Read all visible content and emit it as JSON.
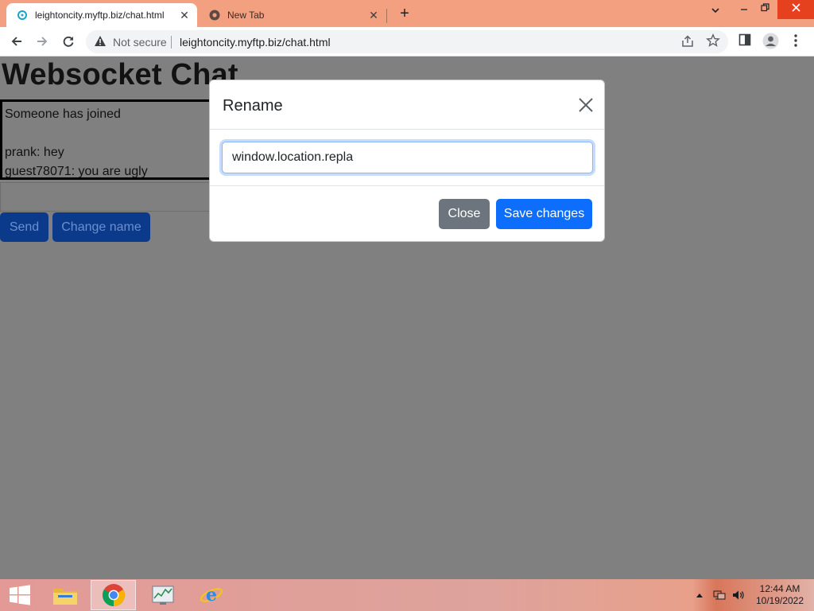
{
  "browser": {
    "tabs": [
      {
        "title": "leightoncity.myftp.biz/chat.html",
        "active": true
      },
      {
        "title": "New Tab",
        "active": false
      }
    ],
    "new_tab_label": "+",
    "security_label": "Not secure",
    "url": "leightoncity.myftp.biz/chat.html"
  },
  "page": {
    "heading": "Websocket Chat",
    "messages": [
      "Someone has joined",
      "",
      "prank: hey",
      "guest78071: you are ugly"
    ],
    "message_input_value": "",
    "send_label": "Send",
    "change_name_label": "Change name"
  },
  "modal": {
    "title": "Rename",
    "input_value": "window.location.repla",
    "close_label": "Close",
    "save_label": "Save changes"
  },
  "taskbar": {
    "apps": [
      "file-explorer",
      "chrome",
      "task-manager",
      "internet-explorer"
    ],
    "time": "12:44 AM",
    "date": "10/19/2022"
  },
  "colors": {
    "titlebar": "#f3a080",
    "overlay": "#808080",
    "primary": "#0d6efd",
    "secondary": "#6c757d"
  }
}
